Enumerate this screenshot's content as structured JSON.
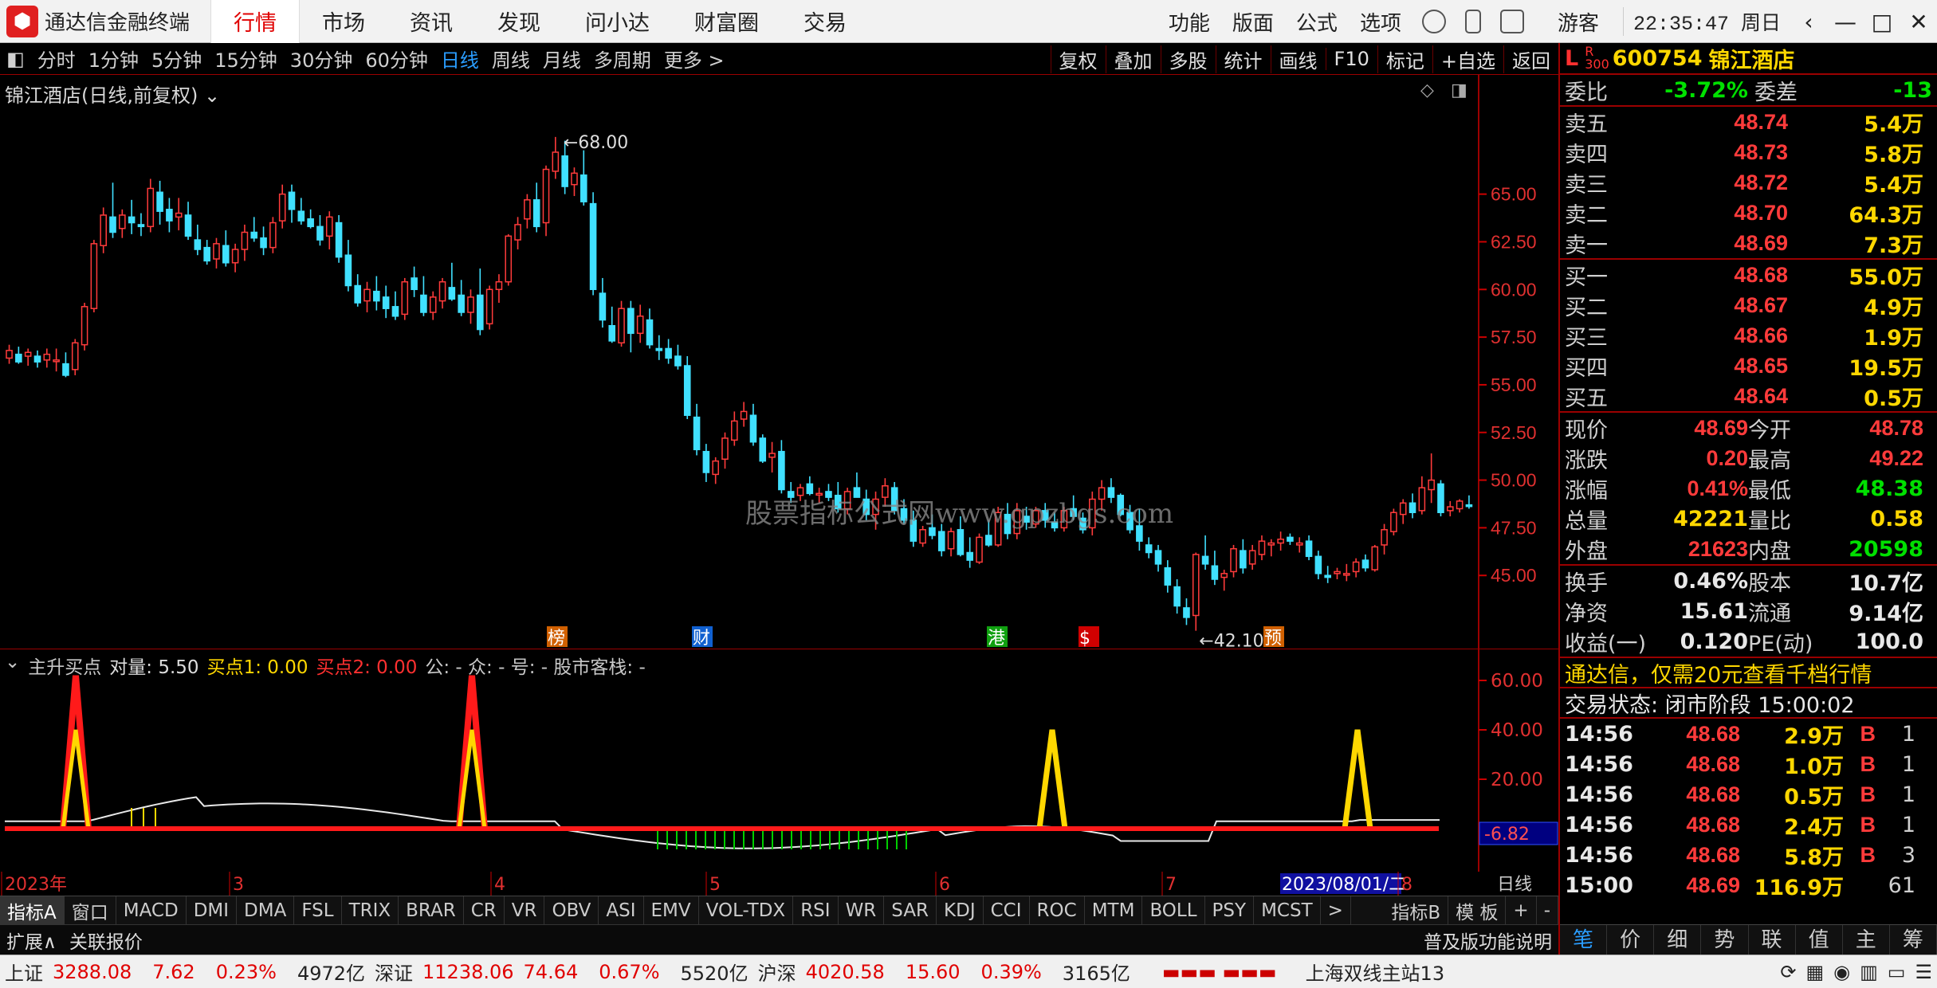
{
  "app": {
    "name": "通达信金融终端",
    "nav": [
      "行情",
      "市场",
      "资讯",
      "发现",
      "问小达",
      "财富圈",
      "交易"
    ],
    "right_menu": [
      "功能",
      "版面",
      "公式",
      "选项"
    ],
    "user": "游客",
    "clock": "22:35:47 周日"
  },
  "toolbar": {
    "periods": [
      "分时",
      "1分钟",
      "5分钟",
      "15分钟",
      "30分钟",
      "60分钟",
      "日线",
      "周线",
      "月线",
      "多周期",
      "更多 >"
    ],
    "active": "日线",
    "tools": [
      "复权",
      "叠加",
      "多股",
      "统计",
      "画线",
      "F10",
      "标记",
      "+自选",
      "返回"
    ]
  },
  "stock": {
    "title": "锦江酒店(日线,前复权)",
    "code": "600754",
    "name": "锦江酒店",
    "high_label": "68.00",
    "low_label": "42.10",
    "watermark": "股票指标公式网www.gpzbgs.com"
  },
  "chart_data": {
    "type": "candlestick",
    "ylim": [
      42,
      70
    ],
    "yticks": [
      "65.00",
      "62.50",
      "60.00",
      "57.50",
      "55.00",
      "52.50",
      "50.00",
      "47.50",
      "45.00"
    ],
    "x_labels": [
      "2023年",
      "3",
      "4",
      "5",
      "6",
      "7",
      "2023/08/01/二",
      "8"
    ],
    "markers": [
      "榜",
      "财",
      "港",
      "$",
      "预"
    ],
    "candles": [
      [
        56.4,
        57.1,
        56.1,
        56.8
      ],
      [
        56.6,
        57.0,
        56.1,
        56.2
      ],
      [
        56.5,
        56.9,
        56.0,
        56.7
      ],
      [
        56.5,
        56.8,
        55.9,
        56.2
      ],
      [
        56.3,
        56.9,
        55.9,
        56.6
      ],
      [
        56.3,
        56.9,
        55.7,
        56.3
      ],
      [
        56.1,
        56.7,
        55.4,
        55.5
      ],
      [
        55.8,
        57.4,
        55.5,
        57.2
      ],
      [
        57.1,
        59.3,
        56.8,
        59.1
      ],
      [
        59.0,
        62.6,
        58.8,
        62.4
      ],
      [
        62.3,
        64.3,
        61.9,
        63.9
      ],
      [
        63.8,
        65.6,
        62.7,
        63.0
      ],
      [
        63.2,
        64.2,
        62.7,
        63.9
      ],
      [
        63.8,
        64.7,
        62.9,
        63.5
      ],
      [
        63.4,
        64.0,
        62.8,
        63.3
      ],
      [
        63.3,
        65.8,
        63.0,
        65.3
      ],
      [
        65.1,
        65.7,
        63.4,
        64.1
      ],
      [
        64.2,
        64.8,
        63.0,
        63.6
      ],
      [
        63.8,
        64.8,
        63.1,
        64.0
      ],
      [
        63.9,
        64.6,
        62.6,
        62.8
      ],
      [
        62.6,
        63.4,
        61.8,
        62.1
      ],
      [
        62.2,
        62.6,
        61.3,
        61.5
      ],
      [
        61.6,
        62.7,
        61.1,
        62.4
      ],
      [
        62.3,
        63.1,
        61.2,
        61.4
      ],
      [
        61.4,
        62.4,
        60.9,
        62.1
      ],
      [
        62.1,
        63.4,
        61.5,
        63.0
      ],
      [
        63.0,
        63.8,
        62.5,
        62.7
      ],
      [
        62.7,
        63.3,
        61.8,
        62.2
      ],
      [
        62.2,
        63.8,
        61.9,
        63.5
      ],
      [
        63.6,
        65.5,
        63.2,
        65.0
      ],
      [
        65.1,
        65.5,
        63.5,
        64.2
      ],
      [
        64.1,
        64.8,
        63.4,
        63.6
      ],
      [
        63.7,
        64.2,
        63.2,
        63.3
      ],
      [
        63.3,
        63.9,
        62.3,
        62.6
      ],
      [
        62.8,
        64.1,
        62.1,
        63.8
      ],
      [
        63.5,
        63.9,
        61.4,
        61.7
      ],
      [
        61.8,
        62.6,
        59.9,
        60.2
      ],
      [
        60.2,
        60.8,
        59.1,
        59.3
      ],
      [
        59.4,
        60.4,
        58.8,
        60.0
      ],
      [
        59.9,
        60.7,
        58.9,
        59.4
      ],
      [
        59.6,
        60.2,
        58.5,
        59.0
      ],
      [
        59.1,
        59.9,
        58.4,
        58.6
      ],
      [
        58.7,
        60.6,
        58.4,
        60.4
      ],
      [
        60.6,
        61.2,
        59.6,
        60.0
      ],
      [
        59.7,
        60.7,
        58.6,
        58.8
      ],
      [
        58.8,
        59.9,
        58.4,
        59.6
      ],
      [
        59.4,
        60.6,
        59.0,
        60.4
      ],
      [
        60.1,
        61.4,
        59.4,
        59.5
      ],
      [
        59.7,
        60.5,
        58.6,
        58.8
      ],
      [
        58.8,
        60.0,
        58.2,
        59.6
      ],
      [
        59.7,
        61.1,
        57.6,
        57.9
      ],
      [
        58.2,
        60.2,
        57.9,
        60.0
      ],
      [
        60.0,
        60.8,
        59.3,
        60.4
      ],
      [
        60.4,
        62.9,
        60.2,
        62.8
      ],
      [
        62.6,
        63.8,
        62.1,
        63.4
      ],
      [
        63.7,
        65.0,
        63.2,
        64.7
      ],
      [
        64.7,
        65.6,
        63.0,
        63.3
      ],
      [
        63.5,
        66.5,
        62.8,
        66.3
      ],
      [
        66.2,
        68.0,
        65.8,
        67.2
      ],
      [
        67.0,
        67.8,
        65.0,
        65.4
      ],
      [
        65.5,
        66.4,
        64.9,
        66.1
      ],
      [
        66.0,
        67.3,
        64.4,
        64.6
      ],
      [
        64.5,
        65.1,
        59.7,
        60.0
      ],
      [
        59.8,
        60.6,
        58.0,
        58.4
      ],
      [
        58.1,
        59.1,
        57.2,
        57.3
      ],
      [
        57.2,
        59.4,
        57.0,
        59.0
      ],
      [
        59.0,
        59.4,
        56.7,
        57.7
      ],
      [
        57.7,
        59.2,
        57.2,
        58.6
      ],
      [
        58.4,
        59.0,
        56.9,
        57.1
      ],
      [
        56.9,
        57.6,
        56.3,
        56.8
      ],
      [
        56.9,
        57.4,
        56.1,
        56.4
      ],
      [
        56.5,
        57.1,
        55.8,
        56.0
      ],
      [
        56.0,
        56.5,
        53.2,
        53.4
      ],
      [
        53.3,
        54.0,
        51.3,
        51.6
      ],
      [
        51.5,
        51.9,
        49.9,
        50.4
      ],
      [
        50.3,
        51.2,
        49.8,
        51.0
      ],
      [
        51.1,
        52.5,
        50.6,
        52.2
      ],
      [
        52.1,
        53.6,
        51.8,
        53.1
      ],
      [
        53.2,
        54.1,
        52.8,
        53.6
      ],
      [
        53.4,
        54.0,
        51.8,
        52.0
      ],
      [
        52.2,
        52.4,
        50.9,
        51.0
      ],
      [
        51.2,
        52.0,
        50.4,
        51.4
      ],
      [
        51.5,
        52.1,
        49.3,
        49.5
      ],
      [
        49.4,
        49.9,
        48.8,
        49.1
      ],
      [
        49.2,
        49.8,
        48.9,
        49.6
      ],
      [
        49.8,
        50.2,
        49.2,
        49.3
      ],
      [
        49.3,
        49.6,
        48.8,
        49.3
      ],
      [
        49.4,
        49.8,
        48.9,
        49.1
      ],
      [
        49.2,
        49.9,
        48.3,
        48.5
      ],
      [
        48.5,
        49.6,
        48.2,
        49.4
      ],
      [
        49.6,
        50.4,
        49.1,
        49.1
      ],
      [
        49.0,
        49.5,
        47.9,
        48.2
      ],
      [
        48.2,
        49.4,
        47.4,
        49.0
      ],
      [
        49.1,
        50.1,
        48.6,
        49.7
      ],
      [
        49.6,
        49.9,
        48.2,
        48.4
      ],
      [
        48.5,
        49.0,
        47.7,
        47.9
      ],
      [
        47.9,
        48.4,
        46.5,
        46.8
      ],
      [
        46.7,
        47.6,
        46.5,
        47.4
      ],
      [
        47.5,
        48.2,
        46.9,
        47.1
      ],
      [
        47.3,
        47.7,
        46.0,
        46.3
      ],
      [
        46.4,
        47.5,
        46.0,
        47.3
      ],
      [
        47.4,
        48.1,
        46.0,
        46.1
      ],
      [
        46.2,
        47.0,
        45.4,
        45.8
      ],
      [
        45.7,
        47.2,
        45.6,
        47.0
      ],
      [
        47.1,
        47.9,
        46.5,
        46.6
      ],
      [
        46.6,
        48.6,
        46.5,
        48.3
      ],
      [
        48.2,
        48.8,
        46.9,
        47.2
      ],
      [
        47.2,
        48.8,
        46.9,
        48.4
      ],
      [
        48.1,
        48.6,
        47.4,
        47.8
      ],
      [
        47.7,
        48.6,
        47.5,
        48.4
      ],
      [
        48.4,
        48.8,
        47.5,
        47.9
      ],
      [
        47.8,
        48.3,
        47.3,
        47.5
      ],
      [
        47.5,
        48.6,
        47.3,
        48.4
      ],
      [
        48.5,
        49.2,
        47.9,
        48.1
      ],
      [
        48.0,
        48.3,
        47.2,
        47.4
      ],
      [
        47.5,
        49.4,
        47.1,
        49.0
      ],
      [
        49.0,
        50.0,
        48.4,
        49.6
      ],
      [
        49.6,
        50.1,
        48.8,
        49.1
      ],
      [
        49.2,
        49.3,
        48.1,
        48.2
      ],
      [
        48.3,
        48.7,
        47.2,
        47.4
      ],
      [
        47.6,
        48.5,
        46.3,
        46.8
      ],
      [
        46.6,
        47.0,
        45.9,
        46.2
      ],
      [
        46.3,
        46.6,
        45.2,
        45.6
      ],
      [
        45.4,
        45.8,
        44.1,
        44.5
      ],
      [
        44.4,
        44.8,
        43.0,
        43.4
      ],
      [
        43.3,
        43.8,
        42.4,
        42.8
      ],
      [
        42.9,
        46.2,
        42.1,
        46.1
      ],
      [
        46.0,
        47.1,
        45.3,
        45.6
      ],
      [
        45.5,
        46.3,
        44.5,
        44.8
      ],
      [
        44.9,
        45.3,
        44.2,
        45.1
      ],
      [
        45.2,
        46.6,
        44.9,
        46.4
      ],
      [
        46.3,
        46.9,
        45.1,
        45.4
      ],
      [
        45.6,
        46.6,
        45.3,
        46.3
      ],
      [
        46.1,
        47.1,
        45.8,
        46.8
      ],
      [
        46.6,
        46.9,
        46.0,
        46.7
      ],
      [
        46.7,
        47.3,
        46.3,
        46.9
      ],
      [
        47.0,
        47.2,
        46.6,
        46.8
      ],
      [
        46.6,
        47.0,
        46.2,
        46.7
      ],
      [
        46.8,
        47.1,
        45.8,
        46.0
      ],
      [
        46.0,
        46.3,
        44.8,
        45.1
      ],
      [
        45.0,
        45.5,
        44.6,
        44.9
      ],
      [
        45.1,
        45.4,
        44.8,
        45.2
      ],
      [
        45.1,
        45.6,
        44.7,
        45.1
      ],
      [
        45.2,
        45.9,
        44.9,
        45.7
      ],
      [
        45.8,
        46.1,
        45.2,
        45.4
      ],
      [
        45.3,
        46.6,
        45.2,
        46.5
      ],
      [
        46.6,
        47.7,
        46.1,
        47.4
      ],
      [
        47.3,
        48.5,
        47.1,
        48.3
      ],
      [
        48.2,
        49.0,
        47.7,
        48.8
      ],
      [
        48.8,
        49.3,
        48.0,
        48.3
      ],
      [
        48.4,
        50.2,
        48.2,
        49.6
      ],
      [
        49.5,
        51.4,
        48.8,
        50.0
      ],
      [
        49.8,
        50.0,
        48.1,
        48.3
      ],
      [
        48.4,
        48.9,
        48.1,
        48.6
      ],
      [
        48.5,
        49.0,
        48.3,
        48.9
      ],
      [
        48.7,
        49.2,
        48.5,
        48.69
      ]
    ]
  },
  "indicator": {
    "header": {
      "name": "主升买点",
      "vol": "对量: 5.50",
      "buy1": "买点1: 0.00",
      "buy2": "买点2: 0.00",
      "misc": "公: -  众: -  号: -  股市客栈: -"
    },
    "yticks": [
      "60.00",
      "40.00",
      "20.00"
    ],
    "cur": "-6.82"
  },
  "tabs": [
    "指标A",
    "窗口",
    "MACD",
    "DMI",
    "DMA",
    "FSL",
    "TRIX",
    "BRAR",
    "CR",
    "VR",
    "OBV",
    "ASI",
    "EMV",
    "VOL-TDX",
    "RSI",
    "WR",
    "SAR",
    "KDJ",
    "CCI",
    "ROC",
    "MTM",
    "BOLL",
    "PSY",
    "MCST",
    ">",
    "指标B",
    "模 板",
    "+",
    "-"
  ],
  "bottom": {
    "expand": "扩展∧",
    "related": "关联报价",
    "help": "普及版功能说明",
    "period": "日线"
  },
  "panel": {
    "code": "600754",
    "name": "锦江酒店",
    "weibi": "-3.72%",
    "weicha": "-13",
    "asks": [
      {
        "l": "卖五",
        "p": "48.74",
        "v": "5.4万"
      },
      {
        "l": "卖四",
        "p": "48.73",
        "v": "5.8万"
      },
      {
        "l": "卖三",
        "p": "48.72",
        "v": "5.4万"
      },
      {
        "l": "卖二",
        "p": "48.70",
        "v": "64.3万"
      },
      {
        "l": "卖一",
        "p": "48.69",
        "v": "7.3万"
      }
    ],
    "bids": [
      {
        "l": "买一",
        "p": "48.68",
        "v": "55.0万"
      },
      {
        "l": "买二",
        "p": "48.67",
        "v": "4.9万"
      },
      {
        "l": "买三",
        "p": "48.66",
        "v": "1.9万"
      },
      {
        "l": "买四",
        "p": "48.65",
        "v": "19.5万"
      },
      {
        "l": "买五",
        "p": "48.64",
        "v": "0.5万"
      }
    ],
    "quote": [
      [
        "现价",
        "48.69",
        "今开",
        "48.78"
      ],
      [
        "涨跌",
        "0.20",
        "最高",
        "49.22"
      ],
      [
        "涨幅",
        "0.41%",
        "最低",
        "48.38"
      ],
      [
        "总量",
        "42221",
        "量比",
        "0.58"
      ],
      [
        "外盘",
        "21623",
        "内盘",
        "20598"
      ]
    ],
    "info": [
      [
        "换手",
        "0.46%",
        "股本",
        "10.7亿"
      ],
      [
        "净资",
        "15.61",
        "流通",
        "9.14亿"
      ],
      [
        "收益(一)",
        "0.120",
        "PE(动)",
        "100.0"
      ]
    ],
    "ad": "通达信，仅需20元查看千档行情",
    "state": "交易状态: 闭市阶段 15:00:02",
    "ticks": [
      [
        "14:56",
        "48.68",
        "2.9万",
        "B",
        "1"
      ],
      [
        "14:56",
        "48.68",
        "1.0万",
        "B",
        "1"
      ],
      [
        "14:56",
        "48.68",
        "0.5万",
        "B",
        "1"
      ],
      [
        "14:56",
        "48.68",
        "2.4万",
        "B",
        "1"
      ],
      [
        "14:56",
        "48.68",
        "5.8万",
        "B",
        "3"
      ],
      [
        "15:00",
        "48.69",
        "116.9万",
        "",
        "61"
      ]
    ],
    "tabs": [
      "笔",
      "价",
      "细",
      "势",
      "联",
      "值",
      "主",
      "筹"
    ]
  },
  "status": {
    "sh": "上证",
    "sh_v": "3288.08",
    "sh_c": "7.62",
    "sh_p": "0.23%",
    "sh_a": "4972亿",
    "sz": "深证",
    "sz_v": "11238.06",
    "sz_c": "74.64",
    "sz_p": "0.67%",
    "sz_a": "5520亿",
    "hs": "沪深",
    "hs_v": "4020.58",
    "hs_c": "15.60",
    "hs_p": "0.39%",
    "hs_a": "3165亿",
    "server": "上海双线主站13"
  }
}
